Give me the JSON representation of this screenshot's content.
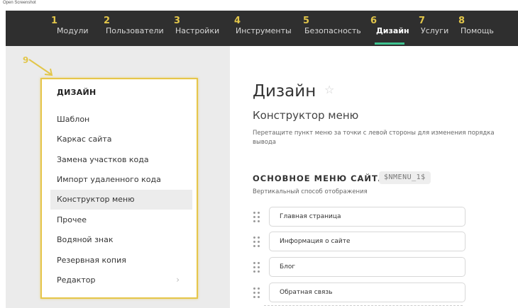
{
  "window": {
    "title": "Open Screenshot"
  },
  "nav": {
    "items": [
      {
        "num": "1",
        "label": "Модули"
      },
      {
        "num": "2",
        "label": "Пользователи"
      },
      {
        "num": "3",
        "label": "Настройки"
      },
      {
        "num": "4",
        "label": "Инструменты"
      },
      {
        "num": "5",
        "label": "Безопасность"
      },
      {
        "num": "6",
        "label": "Дизайн"
      },
      {
        "num": "7",
        "label": "Услуги"
      },
      {
        "num": "8",
        "label": "Помощь"
      }
    ],
    "active": "Дизайн"
  },
  "annotation": {
    "marker": "9"
  },
  "sidebar": {
    "title": "ДИЗАЙН",
    "items": [
      {
        "label": "Шаблон"
      },
      {
        "label": "Каркас сайта"
      },
      {
        "label": "Замена участков кода"
      },
      {
        "label": "Импорт удаленного кода"
      },
      {
        "label": "Конструктор меню"
      },
      {
        "label": "Прочее"
      },
      {
        "label": "Водяной знак"
      },
      {
        "label": "Резервная копия"
      },
      {
        "label": "Редактор"
      }
    ],
    "active": "Конструктор меню"
  },
  "main": {
    "title": "Дизайн",
    "subtitle": "Конструктор меню",
    "description": "Перетащите пункт меню за точки с левой стороны для изменения порядка вывода",
    "section": {
      "title": "ОСНОВНОЕ МЕНЮ САЙТА",
      "variable": "$NMENU_1$",
      "subtitle": "Вертикальный способ отображения",
      "items": [
        {
          "label": "Главная страница"
        },
        {
          "label": "Информация о сайте"
        },
        {
          "label": "Блог"
        },
        {
          "label": "Обратная связь"
        }
      ]
    }
  },
  "colors": {
    "topbar": "#2f2f2f",
    "accent": "#3ec28f",
    "annotation": "#e2c64a",
    "panel": "#ebebeb"
  },
  "icons": {
    "favorite": "star-icon",
    "submenu": "chevron-right-icon",
    "drag": "drag-handle-icon"
  }
}
